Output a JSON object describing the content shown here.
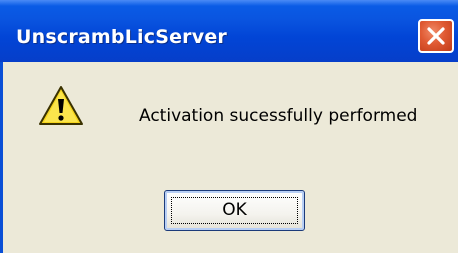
{
  "window": {
    "title": "UnscrambLicServer"
  },
  "dialog": {
    "icon": "warning-icon",
    "message": "Activation sucessfully performed",
    "ok_label": "OK"
  },
  "colors": {
    "titlebar": "#0245d6",
    "body": "#ece9d8",
    "close_button": "#e05a33",
    "warning_fill": "#f5d41c"
  }
}
